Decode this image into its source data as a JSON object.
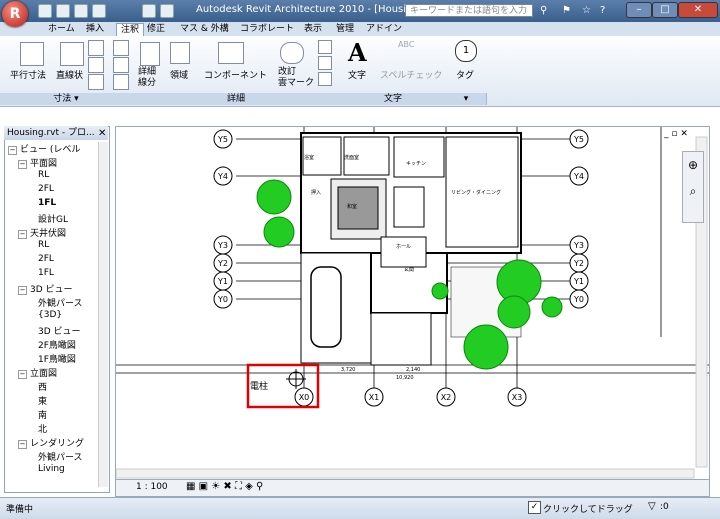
{
  "titlebar": {
    "app_letter": "R",
    "title": "Autodesk Revit Architecture 2010 - [Housing.rvt...",
    "search_placeholder": "キーワードまたは語句を入力"
  },
  "tabs": [
    "ホーム",
    "挿入",
    "注釈",
    "修正",
    "マス & 外構",
    "コラボレート",
    "表示",
    "管理",
    "アドイン"
  ],
  "active_tab": "注釈",
  "ribbon": {
    "dimension": {
      "btn1": "平行寸法",
      "btn2": "直線状",
      "title": "寸法 ▾"
    },
    "detail": {
      "detail_line": "詳細\n線分",
      "region": "領域",
      "component": "コンポーネント",
      "revcloud": "改訂\n雲マーク",
      "title": "詳細"
    },
    "text": {
      "text": "文字",
      "spell": "スペルチェック",
      "abc": "ABC",
      "title": "文字"
    },
    "tag": {
      "tag": "タグ",
      "tag_num": "1",
      "title": "▾"
    }
  },
  "browser": {
    "title": "Housing.rvt - プロ...",
    "items": [
      {
        "label": "ビュー (レベル",
        "level": 0,
        "exp": "−"
      },
      {
        "label": "平面図",
        "level": 1,
        "exp": "−"
      },
      {
        "label": "RL",
        "level": 2
      },
      {
        "label": "2FL",
        "level": 2
      },
      {
        "label": "1FL",
        "level": 2,
        "bold": true
      },
      {
        "label": "設計GL",
        "level": 2
      },
      {
        "label": "天井伏図",
        "level": 1,
        "exp": "−"
      },
      {
        "label": "RL",
        "level": 2
      },
      {
        "label": "2FL",
        "level": 2
      },
      {
        "label": "1FL",
        "level": 2
      },
      {
        "label": "3D ビュー",
        "level": 1,
        "exp": "−"
      },
      {
        "label": "外観パース",
        "level": 2
      },
      {
        "label": "{3D}",
        "level": 2
      },
      {
        "label": "3D ビュー",
        "level": 2
      },
      {
        "label": "2F鳥瞰図",
        "level": 2
      },
      {
        "label": "1F鳥瞰図",
        "level": 2
      },
      {
        "label": "立面図",
        "level": 1,
        "exp": "−"
      },
      {
        "label": "西",
        "level": 2
      },
      {
        "label": "東",
        "level": 2
      },
      {
        "label": "南",
        "level": 2
      },
      {
        "label": "北",
        "level": 2
      },
      {
        "label": "レンダリング",
        "level": 1,
        "exp": "−"
      },
      {
        "label": "外観パース",
        "level": 2
      },
      {
        "label": "Living",
        "level": 2
      }
    ]
  },
  "grids": {
    "y_labels": [
      "Y5",
      "Y4",
      "Y3",
      "Y2",
      "Y1",
      "Y0"
    ],
    "x_labels": [
      "X0",
      "X1",
      "X2",
      "X3"
    ],
    "pillar_label": "電柱",
    "rooms": [
      "浴室",
      "洗面室",
      "キッチン",
      "リビング・ダイニング",
      "和室",
      "ホール",
      "玄関",
      "押入"
    ],
    "dims": [
      "3,720",
      "2,140",
      "10,920"
    ]
  },
  "viewbar": {
    "scale": "1 : 100"
  },
  "status": {
    "ready": "準備中",
    "drag_label": "クリックしてドラッグ",
    "filter_count": ":0"
  },
  "colors": {
    "highlight": "#e00000",
    "tree": "#22cc22",
    "ribbon_blue": "#d6e1ef"
  }
}
